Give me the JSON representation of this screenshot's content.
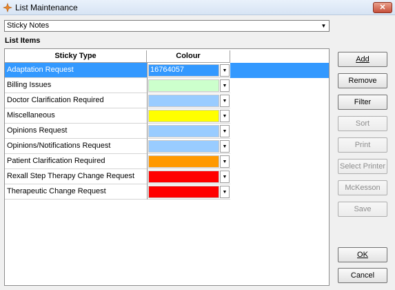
{
  "window": {
    "title": "List Maintenance",
    "close_glyph": "✕"
  },
  "list_selector": {
    "value": "Sticky Notes"
  },
  "list_items_label": "List Items",
  "grid": {
    "headers": {
      "type": "Sticky Type",
      "colour": "Colour"
    },
    "rows": [
      {
        "type": "Adaptation Request",
        "colour": "#3399ff",
        "colour_text": "16764057",
        "selected": true
      },
      {
        "type": "Billing Issues",
        "colour": "#ccffcc"
      },
      {
        "type": "Doctor Clarification Required",
        "colour": "#99ccff"
      },
      {
        "type": "Miscellaneous",
        "colour": "#ffff00"
      },
      {
        "type": "Opinions Request",
        "colour": "#99ccff"
      },
      {
        "type": "Opinions/Notifications Request",
        "colour": "#99ccff"
      },
      {
        "type": "Patient Clarification Required",
        "colour": "#ff9900"
      },
      {
        "type": "Rexall Step Therapy Change Request",
        "colour": "#ff0000"
      },
      {
        "type": "Therapeutic Change Request",
        "colour": "#ff0000"
      }
    ]
  },
  "buttons": {
    "add": "Add",
    "remove": "Remove",
    "filter": "Filter",
    "sort": "Sort",
    "print": "Print",
    "select_printer": "Select Printer",
    "mckesson": "McKesson",
    "save": "Save",
    "ok": "OK",
    "cancel": "Cancel"
  }
}
